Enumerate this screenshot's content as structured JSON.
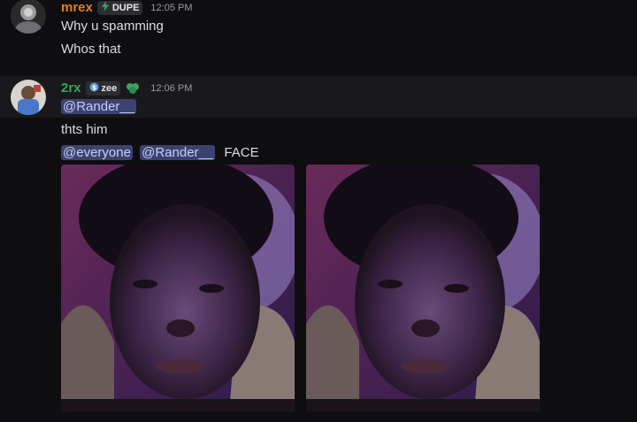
{
  "messages": [
    {
      "author": "mrex",
      "author_color": "#e67e22",
      "tag": "DUPE",
      "tag_icon": "bolt-icon",
      "time": "12:05 PM",
      "lines": [
        "Why u spamming",
        "Whos that"
      ]
    },
    {
      "author": "2rx",
      "author_color": "#3ba55d",
      "tag": "zee",
      "tag_icon": "dollar-icon",
      "badge_icon": "leaf-icon",
      "time": "12:06 PM",
      "mention_reply": "@Rander__",
      "line1": "thts him",
      "mention_everyone": "@everyone",
      "mention_user": "@Rander__",
      "line2_text": "FACE",
      "attachments": [
        "face-photo-1",
        "face-photo-2"
      ]
    }
  ],
  "colors": {
    "background": "#0e0e11",
    "mention_bg": "#3c4270",
    "mention_text": "#c9cdfb"
  }
}
